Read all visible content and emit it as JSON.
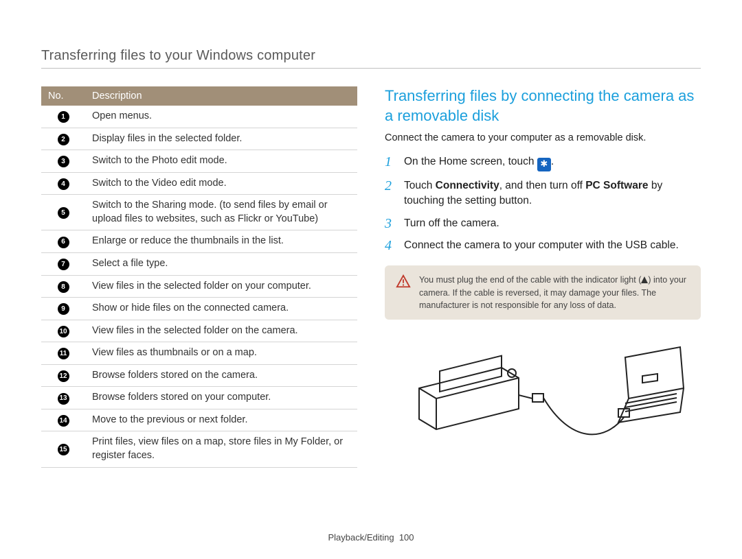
{
  "page_title": "Transferring files to your Windows computer",
  "table": {
    "headers": [
      "No.",
      "Description"
    ],
    "rows": [
      {
        "n": "1",
        "d": "Open menus."
      },
      {
        "n": "2",
        "d": "Display files in the selected folder."
      },
      {
        "n": "3",
        "d": "Switch to the Photo edit mode."
      },
      {
        "n": "4",
        "d": "Switch to the Video edit mode."
      },
      {
        "n": "5",
        "d": "Switch to the Sharing mode. (to send files by email or upload files to websites, such as Flickr or YouTube)"
      },
      {
        "n": "6",
        "d": "Enlarge or reduce the thumbnails in the list."
      },
      {
        "n": "7",
        "d": "Select a file type."
      },
      {
        "n": "8",
        "d": "View files in the selected folder on your computer."
      },
      {
        "n": "9",
        "d": "Show or hide files on the connected camera."
      },
      {
        "n": "10",
        "d": "View files in the selected folder on the camera."
      },
      {
        "n": "11",
        "d": "View files as thumbnails or on a map."
      },
      {
        "n": "12",
        "d": "Browse folders stored on the camera."
      },
      {
        "n": "13",
        "d": "Browse folders stored on your computer."
      },
      {
        "n": "14",
        "d": "Move to the previous or next folder."
      },
      {
        "n": "15",
        "d": "Print files, view files on a map, store files in My Folder, or register faces."
      }
    ]
  },
  "section_title": "Transferring files by connecting the camera as a removable disk",
  "intro": "Connect the camera to your computer as a removable disk.",
  "steps": {
    "s1_pre": "On the Home screen, touch ",
    "s1_post": ".",
    "s2a": "Touch ",
    "s2b": "Connectivity",
    "s2c": ", and then turn off ",
    "s2d": "PC Software",
    "s2e": " by touching the setting button.",
    "s3": "Turn off the camera.",
    "s4": "Connect the camera to your computer with the USB cable."
  },
  "step_numbers": {
    "one": "1",
    "two": "2",
    "three": "3",
    "four": "4"
  },
  "warning_a": "You must plug the end of the cable with the indicator light (",
  "warning_b": ") into your camera. If the cable is reversed, it may damage your files. The manufacturer is not responsible for any loss of data.",
  "footer": {
    "section": "Playback/Editing",
    "page": "100"
  }
}
